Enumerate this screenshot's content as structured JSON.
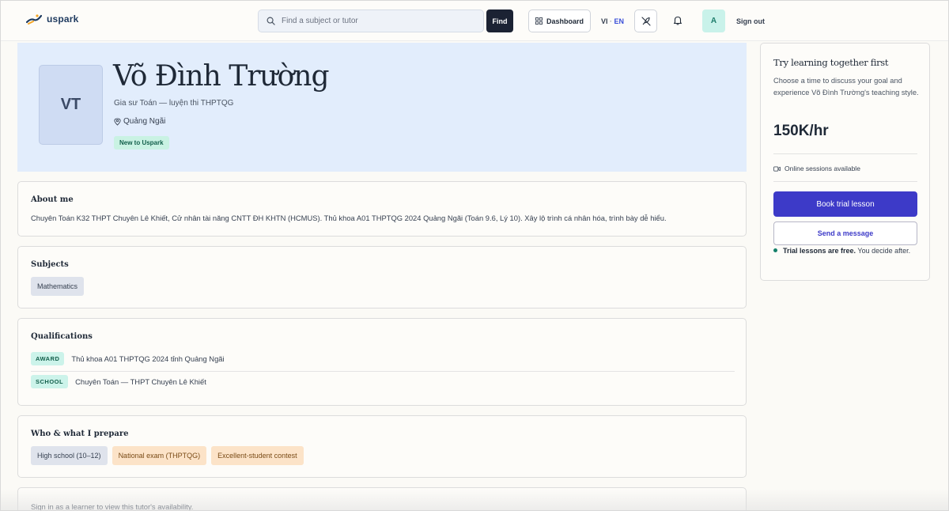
{
  "header": {
    "logo_text": "uspark",
    "search_placeholder": "Find a subject or tutor",
    "find_label": "Find",
    "dashboard_label": "Dashboard",
    "lang_vi": "VI",
    "lang_sep": "·",
    "lang_en": "EN",
    "avatar_initial": "A",
    "signout_label": "Sign out"
  },
  "profile": {
    "initials": "VT",
    "name": "Võ Đình Trường",
    "subtitle": "Gia sư Toán — luyện thi THPTQG",
    "location": "Quảng Ngãi",
    "badge": "New to Uspark"
  },
  "about": {
    "title": "About me",
    "text": "Chuyên Toán K32 THPT Chuyên Lê Khiết, Cử nhân tài năng CNTT ĐH KHTN (HCMUS). Thủ khoa A01 THPTQG 2024 Quảng Ngãi (Toán 9.6, Lý 10). Xây lộ trình cá nhân hóa, trình bày dễ hiểu."
  },
  "subjects": {
    "title": "Subjects",
    "items": [
      "Mathematics"
    ]
  },
  "qualifications": {
    "title": "Qualifications",
    "items": [
      {
        "tag": "AWARD",
        "text": "Thủ khoa A01 THPTQG 2024 tỉnh Quảng Ngãi"
      },
      {
        "tag": "SCHOOL",
        "text": "Chuyên Toán — THPT Chuyên Lê Khiết"
      }
    ]
  },
  "prepare": {
    "title": "Who & what I prepare",
    "items": [
      "High school (10–12)",
      "National exam (THPTQG)",
      "Excellent-student contest"
    ]
  },
  "availability": {
    "text": "Sign in as a learner to view this tutor's availability."
  },
  "sidebar": {
    "title": "Try learning together first",
    "description": "Choose a time to discuss your goal and experience Võ Đình Trường's teaching style.",
    "price": "150K/hr",
    "online": "Online sessions available",
    "book_label": "Book trial lesson",
    "message_label": "Send a message",
    "note_bold": "Trial lessons are free.",
    "note_rest": " You decide after."
  },
  "colors": {
    "accent": "#3d3ac8",
    "hero_bg": "#e2edfc",
    "badge_bg": "#c9f2e3"
  }
}
